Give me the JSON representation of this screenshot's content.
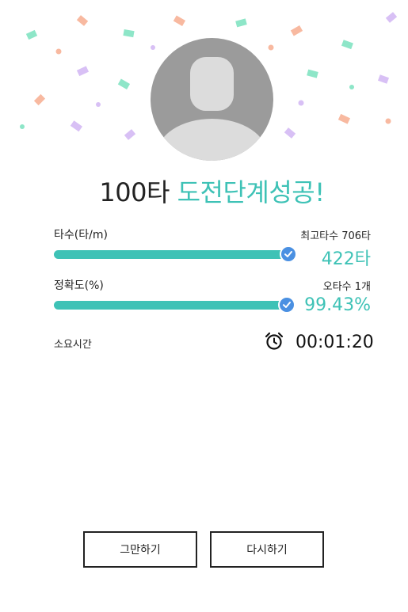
{
  "result": {
    "title_stage": "100타",
    "title_success": "도전단계성공!"
  },
  "speed": {
    "label": "타수(타/m)",
    "best_text": "최고타수 706타",
    "value": "422타",
    "progress": 1.0
  },
  "accuracy": {
    "label": "정확도(%)",
    "typo_text": "오타수 1개",
    "value": "99.43%",
    "progress": 0.9943
  },
  "time": {
    "label": "소요시간",
    "value": "00:01:20"
  },
  "buttons": {
    "quit_label": "그만하기",
    "retry_label": "다시하기"
  },
  "icons": {
    "avatar": "user-avatar-icon",
    "check": "check-circle-icon",
    "alarm": "alarm-clock-icon"
  },
  "colors": {
    "accent": "#3ec2b6",
    "check_blue": "#4a90e2",
    "avatar_gray": "#9b9b9b"
  }
}
